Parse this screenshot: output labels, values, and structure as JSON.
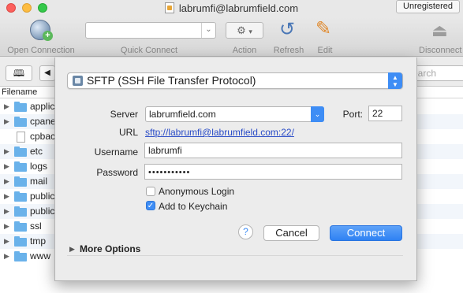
{
  "window": {
    "title": "labrumfi@labrumfield.com",
    "badge": "Unregistered"
  },
  "toolbar": {
    "open_connection": "Open Connection",
    "quick_connect": "Quick Connect",
    "action": "Action",
    "refresh": "Refresh",
    "edit": "Edit",
    "disconnect": "Disconnect"
  },
  "browser": {
    "search_placeholder": "Search",
    "column_filename": "Filename",
    "files": [
      {
        "name": "applic",
        "type": "folder"
      },
      {
        "name": "cpane",
        "type": "folder"
      },
      {
        "name": "cpbac",
        "type": "file"
      },
      {
        "name": "etc",
        "type": "folder"
      },
      {
        "name": "logs",
        "type": "folder"
      },
      {
        "name": "mail",
        "type": "folder"
      },
      {
        "name": "public",
        "type": "folder"
      },
      {
        "name": "public",
        "type": "folder"
      },
      {
        "name": "ssl",
        "type": "folder"
      },
      {
        "name": "tmp",
        "type": "folder"
      },
      {
        "name": "www",
        "type": "folder"
      }
    ]
  },
  "dialog": {
    "protocol": "SFTP (SSH File Transfer Protocol)",
    "server_label": "Server",
    "server_value": "labrumfield.com",
    "port_label": "Port:",
    "port_value": "22",
    "url_label": "URL",
    "url_value": "sftp://labrumfi@labrumfield.com:22/",
    "username_label": "Username",
    "username_value": "labrumfi",
    "password_label": "Password",
    "password_value": "•••••••••••",
    "anonymous_label": "Anonymous Login",
    "anonymous_checked": false,
    "keychain_label": "Add to Keychain",
    "keychain_checked": true,
    "help": "?",
    "cancel": "Cancel",
    "connect": "Connect",
    "more_options": "More Options"
  },
  "colors": {
    "accent": "#3e8df5",
    "folder": "#6ab2ea",
    "link": "#2a4cc7"
  }
}
